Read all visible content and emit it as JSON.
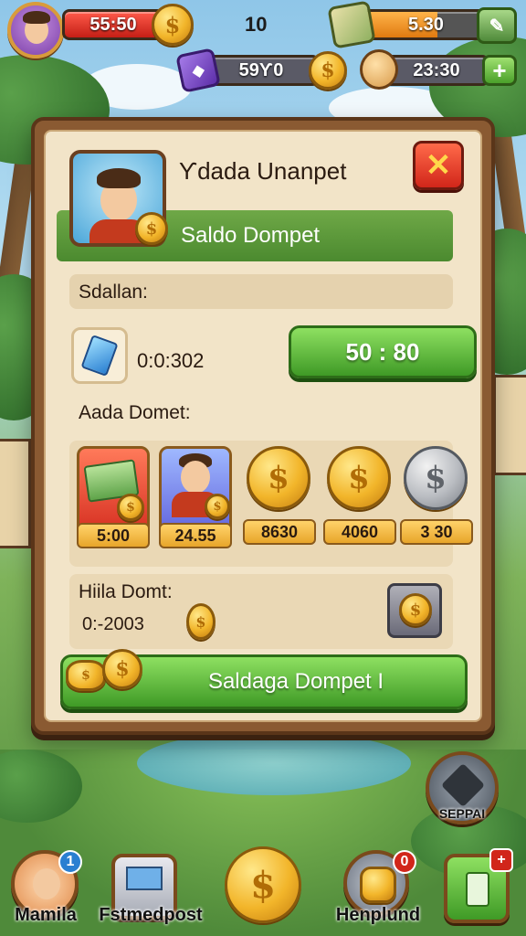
{
  "hud": {
    "player_stat": "55:50",
    "level": "10",
    "energy_value": "5.30",
    "energy_fill": 0.62,
    "gems_value": "59Ƴ0",
    "pet_value": "23:30",
    "coin_symbol": "$",
    "plus_symbol": "+"
  },
  "panel": {
    "title": "Ƴdada Unanpet",
    "close_symbol": "✕",
    "subtitle": "Saldo Dompet",
    "section1_label": "Sdallan:",
    "timer_value": "0:0:302",
    "collect_button": "50 : 80",
    "section2_label": "Aada Domet:",
    "items": [
      {
        "price": "5:00"
      },
      {
        "price": "24.55"
      },
      {
        "price": "8630"
      },
      {
        "price": "4060"
      },
      {
        "price": "3 30"
      }
    ],
    "history_label": "Hiila Domt:",
    "history_date": "0:-2003",
    "main_button": "Saldaga Dompet  I"
  },
  "side": {
    "sepam_label": "SEPPAI"
  },
  "nav": {
    "profile_label": "Mamila",
    "profile_badge": "1",
    "shop_label": "Fstmedpost",
    "coins_symbol": "$",
    "help_label": "Henplund",
    "help_badge": "0",
    "menu_badge": "+"
  },
  "colors": {
    "panel_wood": "#8a5a32",
    "panel_paper": "#f2e4c8",
    "accent_green": "#4b8a2f",
    "close_red": "#d1261a",
    "coin_gold": "#f2b52a"
  },
  "icons": [
    "avatar-icon",
    "coin-icon",
    "energy-icon",
    "dice-gem-icon",
    "pet-icon",
    "close-icon",
    "blue-gem-icon",
    "cash-icon",
    "ninja-star-icon",
    "shop-terminal-icon",
    "coin-stack-icon",
    "menu-list-icon"
  ]
}
